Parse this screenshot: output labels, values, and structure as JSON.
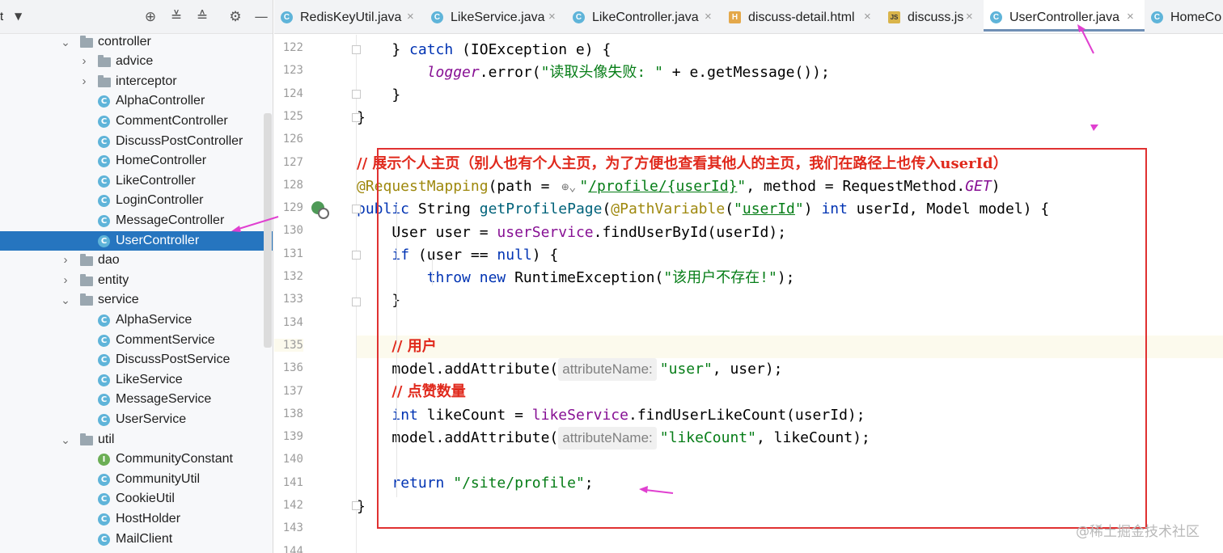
{
  "sidebar": {
    "title": "t",
    "tools": [
      "crosshair-icon",
      "expand-all-icon",
      "collapse-all-icon",
      "gear-icon",
      "minimize-icon"
    ],
    "tree": [
      {
        "label": "controller",
        "type": "folder",
        "expanded": true
      },
      {
        "label": "advice",
        "type": "folder",
        "expanded": false
      },
      {
        "label": "interceptor",
        "type": "folder",
        "expanded": false
      },
      {
        "label": "AlphaController",
        "type": "class"
      },
      {
        "label": "CommentController",
        "type": "class"
      },
      {
        "label": "DiscussPostController",
        "type": "class"
      },
      {
        "label": "HomeController",
        "type": "class"
      },
      {
        "label": "LikeController",
        "type": "class"
      },
      {
        "label": "LoginController",
        "type": "class"
      },
      {
        "label": "MessageController",
        "type": "class"
      },
      {
        "label": "UserController",
        "type": "class",
        "selected": true
      },
      {
        "label": "dao",
        "type": "folder",
        "expanded": false
      },
      {
        "label": "entity",
        "type": "folder",
        "expanded": false
      },
      {
        "label": "service",
        "type": "folder",
        "expanded": true
      },
      {
        "label": "AlphaService",
        "type": "class"
      },
      {
        "label": "CommentService",
        "type": "class"
      },
      {
        "label": "DiscussPostService",
        "type": "class"
      },
      {
        "label": "LikeService",
        "type": "class"
      },
      {
        "label": "MessageService",
        "type": "class"
      },
      {
        "label": "UserService",
        "type": "class"
      },
      {
        "label": "util",
        "type": "folder",
        "expanded": true
      },
      {
        "label": "CommunityConstant",
        "type": "interface"
      },
      {
        "label": "CommunityUtil",
        "type": "class"
      },
      {
        "label": "CookieUtil",
        "type": "class"
      },
      {
        "label": "HostHolder",
        "type": "class"
      },
      {
        "label": "MailClient",
        "type": "class"
      }
    ]
  },
  "tabs": [
    {
      "label": "RedisKeyUtil.java",
      "icon": "java-class-icon"
    },
    {
      "label": "LikeService.java",
      "icon": "java-class-icon"
    },
    {
      "label": "LikeController.java",
      "icon": "java-class-icon"
    },
    {
      "label": "discuss-detail.html",
      "icon": "html-file-icon"
    },
    {
      "label": "discuss.js",
      "icon": "js-file-icon"
    },
    {
      "label": "UserController.java",
      "icon": "java-class-icon",
      "active": true
    },
    {
      "label": "HomeCo",
      "icon": "java-class-icon"
    }
  ],
  "editor": {
    "line_numbers": [
      "122",
      "123",
      "124",
      "125",
      "126",
      "127",
      "128",
      "129",
      "130",
      "131",
      "132",
      "133",
      "134",
      "135",
      "136",
      "137",
      "138",
      "139",
      "140",
      "141",
      "142",
      "143",
      "144"
    ],
    "highlighted_line": "135",
    "lines": {
      "l122": {
        "kw1": "catch",
        "rest": " (IOException e) {"
      },
      "l123": {
        "logger": "logger",
        "call": ".error(",
        "str": "\"读取头像失败: \"",
        "rest": " + e.getMessage());"
      },
      "l124": "}",
      "l125": "}",
      "l127": "// 展示个人主页（别人也有个人主页，为了方便也查看其他人的主页，我们在路径上也传入userId）",
      "l128": {
        "anno": "@RequestMapping",
        "p1": "(path = ",
        "str_q1": "\"",
        "str_u": "/profile/{userId}",
        "str_q2": "\"",
        "p2": ", method = RequestMethod.",
        "get": "GET",
        "p3": ")"
      },
      "l129": {
        "kw1": "public",
        "p1": " String ",
        "method": "getProfilePage",
        "p2": "(",
        "anno": "@PathVariable",
        "p3": "(",
        "str_q1": "\"",
        "str_u": "userId",
        "str_q2": "\"",
        "p4": ") ",
        "kw2": "int",
        "p5": " userId, Model model) {"
      },
      "l130": {
        "p1": "User user = ",
        "field": "userService",
        "p2": ".findUserById(userId);"
      },
      "l131": {
        "kw1": "if",
        "p1": " (user == ",
        "kw2": "null",
        "p2": ") {"
      },
      "l132": {
        "kw1": "throw",
        "p1": " ",
        "kw2": "new",
        "p2": " RuntimeException(",
        "str": "\"该用户不存在!\"",
        "p3": ");"
      },
      "l133": "}",
      "l135": "// 用户",
      "l136": {
        "p1": "model.addAttribute(",
        "hint": "attributeName:",
        "str": "\"user\"",
        "p2": ", user);"
      },
      "l137": "// 点赞数量",
      "l138": {
        "kw1": "int",
        "p1": " likeCount = ",
        "field": "likeService",
        "p2": ".findUserLikeCount(userId);"
      },
      "l139": {
        "p1": "model.addAttribute(",
        "hint": "attributeName:",
        "str": "\"likeCount\"",
        "p2": ", likeCount);"
      },
      "l141": {
        "kw1": "return",
        "p1": " ",
        "str": "\"/site/profile\"",
        "p2": ";"
      },
      "l142": "}"
    }
  },
  "watermark": "@稀土掘金技术社区",
  "colors": {
    "annotation_box": "#e03131",
    "arrows": "#e040d0",
    "selection": "#2675bf"
  }
}
